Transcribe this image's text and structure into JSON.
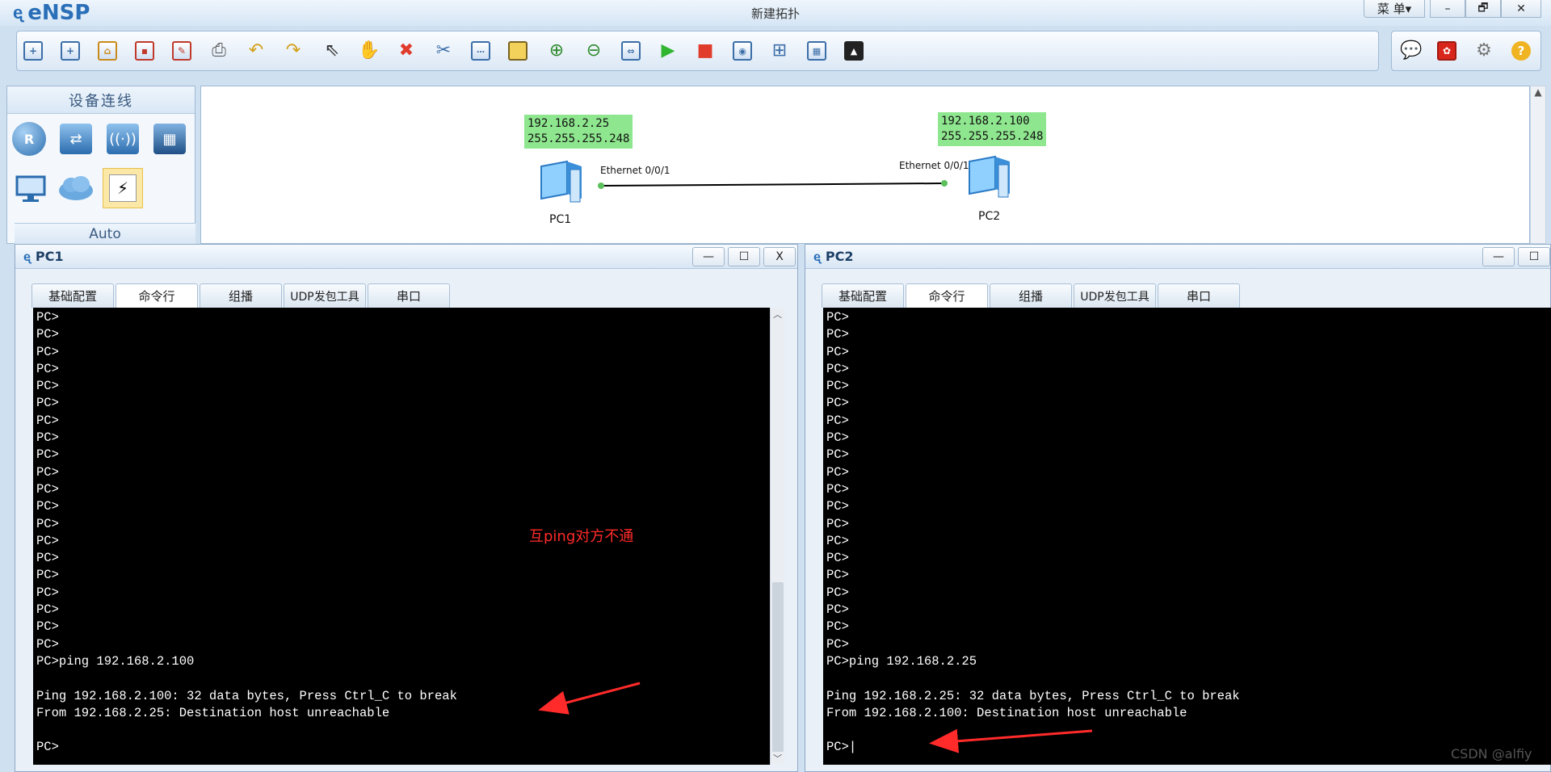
{
  "app": {
    "name": "eNSP",
    "window_title": "新建拓扑",
    "menu_label": "菜 单▾",
    "window_controls": [
      "–",
      "🗗",
      "✕"
    ]
  },
  "toolbar": {
    "icons": [
      "new-topology-icon",
      "new-topology-lab-icon",
      "open-icon",
      "save-icon",
      "save-as-icon",
      "print-icon",
      "undo-icon",
      "redo-icon",
      "select-icon",
      "pan-hand-icon",
      "delete-icon",
      "delete-link-icon",
      "text-note-icon",
      "rectangle-icon",
      "zoom-in-icon",
      "zoom-out-icon",
      "fit-view-icon",
      "start-device-icon",
      "stop-device-icon",
      "capture-icon",
      "topology-icon",
      "grid-icon",
      "screenshot-icon"
    ],
    "right_icons": [
      "chat-icon",
      "huawei-icon",
      "settings-icon",
      "help-icon"
    ]
  },
  "device_panel": {
    "title": "设备连线",
    "auto_label": "Auto",
    "router_glyph": "R",
    "devices": [
      "router-icon",
      "switch-icon",
      "wireless-icon",
      "firewall-icon",
      "pc-icon",
      "cloud-icon",
      "link-auto-icon"
    ]
  },
  "topology": {
    "pc1": {
      "name": "PC1",
      "ip": "192.168.2.25",
      "mask": "255.255.255.248",
      "port": "Ethernet 0/0/1"
    },
    "pc2": {
      "name": "PC2",
      "ip": "192.168.2.100",
      "mask": "255.255.255.248",
      "port": "Ethernet 0/0/1"
    },
    "link_color": "#000000",
    "label_bg": "#8ee68e"
  },
  "pc1_window": {
    "title": "PC1",
    "tabs": [
      "基础配置",
      "命令行",
      "组播",
      "UDP发包工具",
      "串口"
    ],
    "active_tab": 1,
    "controls": [
      "—",
      "☐",
      "X"
    ],
    "console": "PC>\nPC>\nPC>\nPC>\nPC>\nPC>\nPC>\nPC>\nPC>\nPC>\nPC>\nPC>\nPC>\nPC>\nPC>\nPC>\nPC>\nPC>\nPC>\nPC>\nPC>ping 192.168.2.100\n\nPing 192.168.2.100: 32 data bytes, Press Ctrl_C to break\nFrom 192.168.2.25: Destination host unreachable\n\nPC>"
  },
  "pc2_window": {
    "title": "PC2",
    "tabs": [
      "基础配置",
      "命令行",
      "组播",
      "UDP发包工具",
      "串口"
    ],
    "active_tab": 1,
    "controls": [
      "—",
      "☐"
    ],
    "console": "PC>\nPC>\nPC>\nPC>\nPC>\nPC>\nPC>\nPC>\nPC>\nPC>\nPC>\nPC>\nPC>\nPC>\nPC>\nPC>\nPC>\nPC>\nPC>\nPC>\nPC>ping 192.168.2.25\n\nPing 192.168.2.25: 32 data bytes, Press Ctrl_C to break\nFrom 192.168.2.100: Destination host unreachable\n\nPC>|"
  },
  "annotation": {
    "text": "互ping对方不通",
    "color": "#ff2a2a"
  },
  "watermark": "CSDN @alfiy"
}
